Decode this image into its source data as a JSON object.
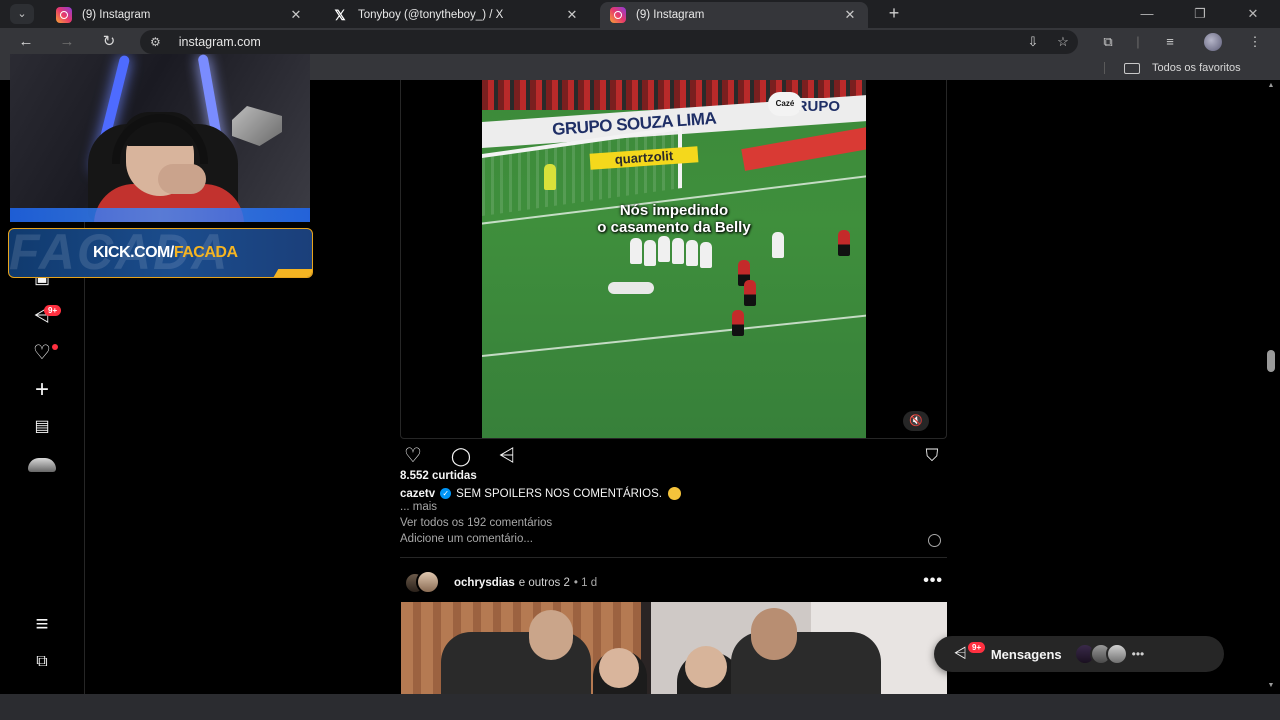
{
  "browser": {
    "tabs": [
      {
        "title": "(9) Instagram",
        "icon": "instagram-icon",
        "active": false
      },
      {
        "title": "Tonyboy (@tonytheboy_) / X",
        "icon": "x-icon",
        "active": false
      },
      {
        "title": "(9) Instagram",
        "icon": "instagram-icon",
        "active": true
      }
    ],
    "url": "instagram.com",
    "bookmarks_folder": "Todos os favoritos"
  },
  "sidenav": {
    "notifications_badge": "9+"
  },
  "stream_overlay": {
    "banner_prefix": "KICK.COM/",
    "banner_accent": "FACADA",
    "banner_bg": "FACADA",
    "brand_color": "#f5b422"
  },
  "post1": {
    "video_caption_line1": "Nós impedindo",
    "video_caption_line2": "o casamento da Belly",
    "ad_board": "GRUPO SOUZA LIMA",
    "ad_board_right": "GRUPO",
    "sponsor": "quartzolit",
    "watermark": "Cazé",
    "likes": "8.552 curtidas",
    "author": "cazetv",
    "caption": "SEM SPOILERS NOS COMENTÁRIOS.",
    "more": "... mais",
    "view_comments": "Ver todos os 192 comentários",
    "add_comment": "Adicione um comentário..."
  },
  "post2": {
    "user": "ochrysdias",
    "others": "e outros 2",
    "time": "• 1 d"
  },
  "messages": {
    "label": "Mensagens",
    "badge": "9+"
  },
  "colors": {
    "instagram_red": "#ff3040",
    "verified_blue": "#0095f6",
    "background": "#000000"
  }
}
